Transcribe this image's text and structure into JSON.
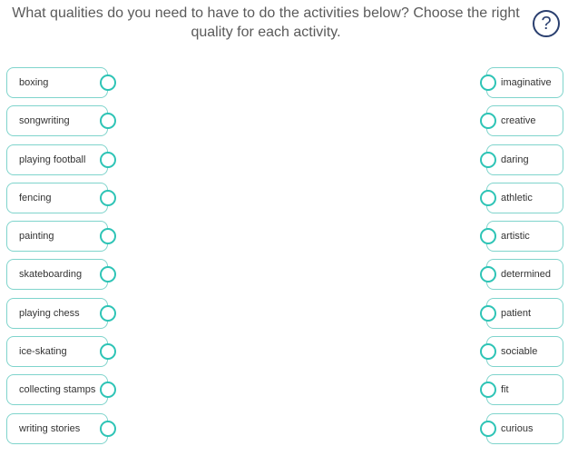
{
  "question": {
    "text": "What qualities do you need to have to do the activities below? Choose the right quality for each activity."
  },
  "help": {
    "label": "?"
  },
  "activities": [
    "boxing",
    "songwriting",
    "playing football",
    "fencing",
    "painting",
    "skateboarding",
    "playing chess",
    "ice-skating",
    "collecting stamps",
    "writing stories"
  ],
  "qualities": [
    "imaginative",
    "creative",
    "daring",
    "athletic",
    "artistic",
    "determined",
    "patient",
    "sociable",
    "fit",
    "curious"
  ],
  "colors": {
    "accent": "#2ec4b6",
    "pill_border": "#7fd4cc",
    "help": "#2a3f6f"
  }
}
